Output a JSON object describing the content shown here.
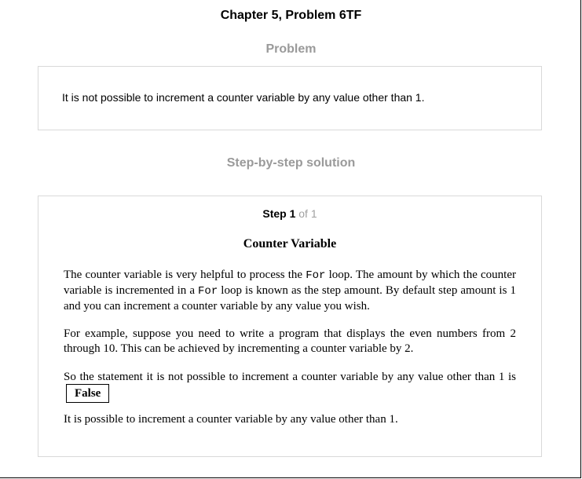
{
  "header": {
    "title": "Chapter 5, Problem 6TF"
  },
  "problem": {
    "heading": "Problem",
    "text": "It is not possible to increment a counter variable by any value other than 1."
  },
  "solution": {
    "heading": "Step-by-step solution",
    "step_word": "Step 1",
    "step_of": "of 1",
    "section_title": "Counter Variable",
    "para1_a": "The counter variable is very helpful to process the ",
    "para1_code1": "For",
    "para1_b": " loop. The amount by which the counter variable is incremented in a ",
    "para1_code2": "For",
    "para1_c": " loop is known as the step amount. By default step amount is 1 and you can increment a counter variable by any value you wish.",
    "para2": "For example, suppose you need to write a program that displays the even numbers from 2 through 10. This can be achieved by incrementing a counter variable by 2.",
    "para3_text": "So the statement it is not possible to increment a counter variable by any value other than 1 is",
    "answer": "False",
    "para4": "It is possible to increment a counter variable by any value other than 1."
  }
}
